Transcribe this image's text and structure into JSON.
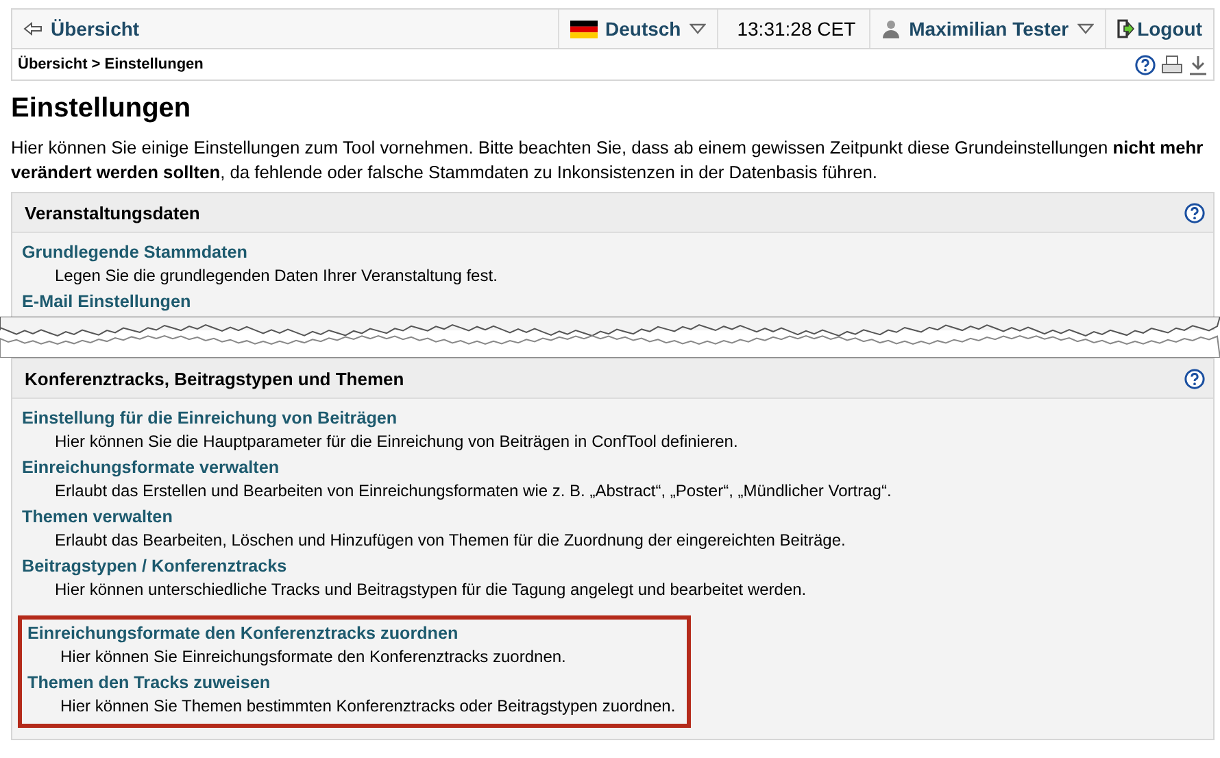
{
  "topbar": {
    "back": "Übersicht",
    "language": "Deutsch",
    "time": "13:31:28 CET",
    "user": "Maximilian Tester",
    "logout": "Logout"
  },
  "breadcrumb": "Übersicht > Einstellungen",
  "title": "Einstellungen",
  "intro": "Hier können Sie einige Einstellungen zum Tool vornehmen. Bitte beachten Sie, dass ab einem gewissen Zeitpunkt diese Grundeinstellungen **nicht mehr verändert werden sollten**, da fehlende oder falsche Stammdaten zu Inkonsistenzen in der Datenbasis führen.",
  "sections": [
    {
      "title": "Veranstaltungsdaten",
      "torn": true,
      "items": [
        {
          "link": "Grundlegende Stammdaten",
          "description": "Legen Sie die grundlegenden Daten Ihrer Veranstaltung fest."
        },
        {
          "link": "E-Mail Einstellungen"
        }
      ]
    },
    {
      "title": "Konferenztracks, Beitragstypen und Themen",
      "torn": false,
      "items": [
        {
          "link": "Einstellung für die Einreichung von Beiträgen",
          "description": "Hier können Sie die Hauptparameter für die Einreichung von Beiträgen in ConfTool definieren."
        },
        {
          "link": "Einreichungsformate verwalten",
          "description": "Erlaubt das Erstellen und Bearbeiten von Einreichungsformaten wie z. B. „Abstract“, „Poster“, „Mündlicher Vortrag“."
        },
        {
          "link": "Themen verwalten",
          "description": "Erlaubt das Bearbeiten, Löschen und Hinzufügen von Themen für die Zuordnung der eingereichten Beiträge."
        },
        {
          "link": "Beitragstypen / Konferenztracks",
          "description": "Hier können unterschiedliche Tracks und Beitragstypen für die Tagung angelegt und bearbeitet werden."
        }
      ],
      "highlighted_items": [
        {
          "link": "Einreichungsformate den Konferenztracks zuordnen",
          "description": "Hier können Sie Einreichungsformate den Konferenztracks zuordnen."
        },
        {
          "link": "Themen den Tracks zuweisen",
          "description": "Hier können Sie Themen bestimmten Konferenztracks oder Beitragstypen zuordnen."
        }
      ]
    }
  ]
}
